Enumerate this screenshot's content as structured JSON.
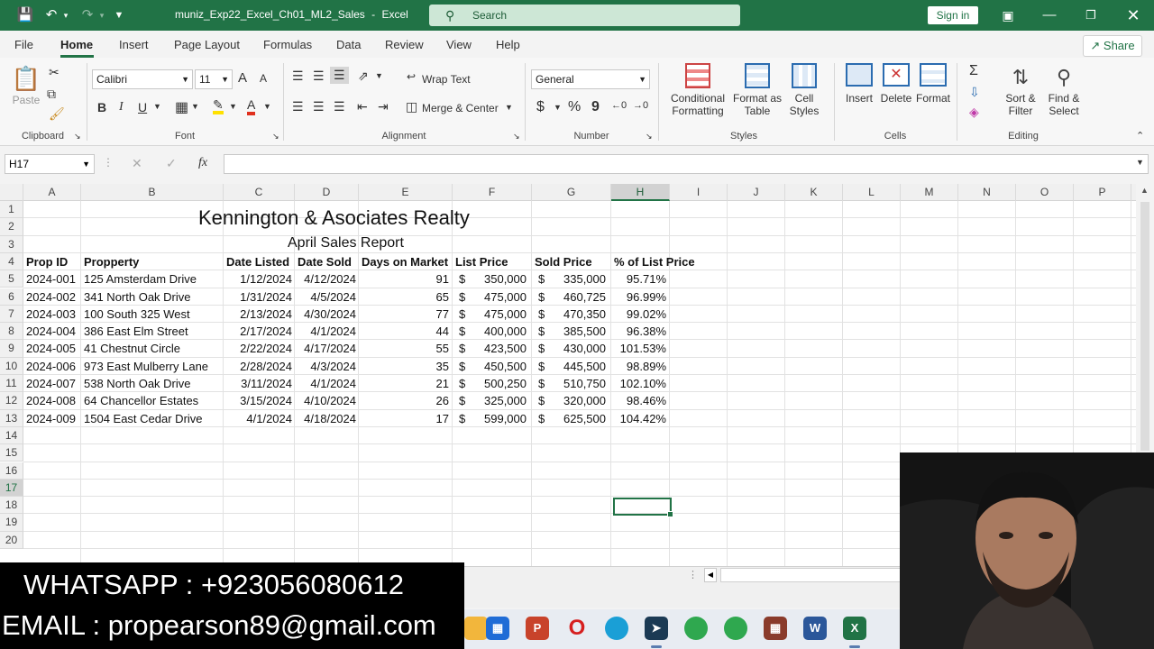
{
  "titlebar": {
    "file_title": "muniz_Exp22_Excel_Ch01_ML2_Sales",
    "app": "Excel",
    "separator": "-",
    "search_placeholder": "Search",
    "signin": "Sign in"
  },
  "menu": {
    "tabs": [
      "File",
      "Home",
      "Insert",
      "Page Layout",
      "Formulas",
      "Data",
      "Review",
      "View",
      "Help"
    ],
    "active": "Home",
    "share": "Share"
  },
  "ribbon": {
    "clipboard": {
      "label": "Clipboard",
      "paste": "Paste"
    },
    "font": {
      "label": "Font",
      "name": "Calibri",
      "size": "11",
      "grow": "A",
      "shrink": "A",
      "bold": "B",
      "italic": "I",
      "underline": "U",
      "fontcolor": "A"
    },
    "alignment": {
      "label": "Alignment",
      "wrap": "Wrap Text",
      "merge": "Merge & Center"
    },
    "number": {
      "label": "Number",
      "format": "General",
      "currency": "$",
      "percent": "%",
      "comma": "9"
    },
    "styles": {
      "label": "Styles",
      "cond1": "Conditional",
      "cond2": "Formatting",
      "fmt1": "Format as",
      "fmt2": "Table",
      "cell1": "Cell",
      "cell2": "Styles"
    },
    "cells": {
      "label": "Cells",
      "insert": "Insert",
      "delete": "Delete",
      "format": "Format"
    },
    "editing": {
      "label": "Editing",
      "sort1": "Sort &",
      "sort2": "Filter",
      "find1": "Find &",
      "find2": "Select"
    }
  },
  "formula_bar": {
    "name_box": "H17",
    "fx": "fx",
    "value": ""
  },
  "columns": [
    "A",
    "B",
    "C",
    "D",
    "E",
    "F",
    "G",
    "H",
    "I",
    "J",
    "K",
    "L",
    "M",
    "N",
    "O",
    "P"
  ],
  "selected_column": "H",
  "rows": [
    "1",
    "2",
    "3",
    "4",
    "5",
    "6",
    "7",
    "8",
    "9",
    "10",
    "11",
    "12",
    "13",
    "14",
    "15",
    "16",
    "17",
    "18",
    "19",
    "20"
  ],
  "selected_row": "17",
  "sheet": {
    "title": "Kennington & Asociates Realty",
    "subtitle": "April Sales Report",
    "headers": [
      "Prop ID",
      "Propperty",
      "Date Listed",
      "Date Sold",
      "Days on Market",
      "List Price",
      "Sold Price",
      "% of List Price"
    ],
    "data": [
      [
        "2024-001",
        "125 Amsterdam Drive",
        "1/12/2024",
        "4/12/2024",
        "91",
        "$",
        "350,000",
        "$",
        "335,000",
        "95.71%"
      ],
      [
        "2024-002",
        "341 North Oak Drive",
        "1/31/2024",
        "4/5/2024",
        "65",
        "$",
        "475,000",
        "$",
        "460,725",
        "96.99%"
      ],
      [
        "2024-003",
        "100 South 325 West",
        "2/13/2024",
        "4/30/2024",
        "77",
        "$",
        "475,000",
        "$",
        "470,350",
        "99.02%"
      ],
      [
        "2024-004",
        "386 East Elm Street",
        "2/17/2024",
        "4/1/2024",
        "44",
        "$",
        "400,000",
        "$",
        "385,500",
        "96.38%"
      ],
      [
        "2024-005",
        "41 Chestnut Circle",
        "2/22/2024",
        "4/17/2024",
        "55",
        "$",
        "423,500",
        "$",
        "430,000",
        "101.53%"
      ],
      [
        "2024-006",
        "973 East Mulberry Lane",
        "2/28/2024",
        "4/3/2024",
        "35",
        "$",
        "450,500",
        "$",
        "445,500",
        "98.89%"
      ],
      [
        "2024-007",
        "538 North Oak Drive",
        "3/11/2024",
        "4/1/2024",
        "21",
        "$",
        "500,250",
        "$",
        "510,750",
        "102.10%"
      ],
      [
        "2024-008",
        "64 Chancellor Estates",
        "3/15/2024",
        "4/10/2024",
        "26",
        "$",
        "325,000",
        "$",
        "320,000",
        "98.46%"
      ],
      [
        "2024-009",
        "1504 East Cedar Drive",
        "4/1/2024",
        "4/18/2024",
        "17",
        "$",
        "599,000",
        "$",
        "625,500",
        "104.42%"
      ]
    ]
  },
  "overlay": {
    "whatsapp": "WHATSAPP : +923056080612",
    "email": "EMAIL : propearson89@gmail.com"
  },
  "taskbar": {
    "powerpoint": "P",
    "word": "W",
    "excel": "X"
  },
  "colors": {
    "excel_green": "#217346",
    "overlay_bg": "#000000"
  }
}
